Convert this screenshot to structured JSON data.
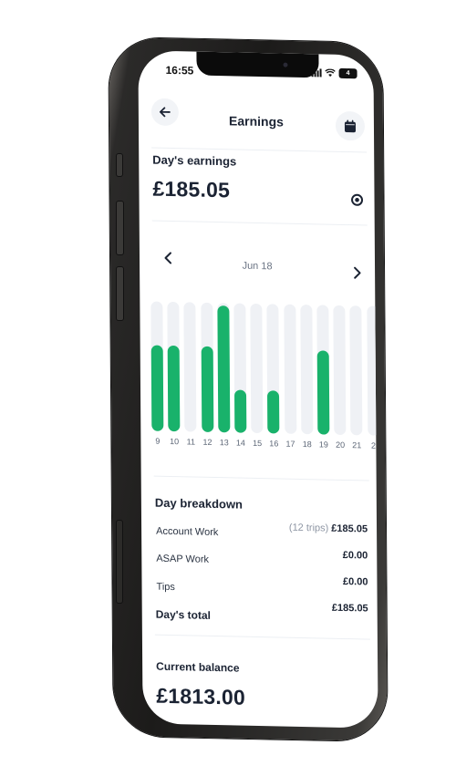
{
  "status_bar": {
    "time": "16:55",
    "battery": "4"
  },
  "header": {
    "title": "Earnings"
  },
  "day_earnings": {
    "label": "Day's earnings",
    "amount": "£185.05"
  },
  "date_nav": {
    "date": "Jun 18"
  },
  "chart_data": {
    "type": "bar",
    "categories": [
      "9",
      "10",
      "11",
      "12",
      "13",
      "14",
      "15",
      "16",
      "17",
      "18",
      "19",
      "20",
      "21",
      "2"
    ],
    "values": [
      0.66,
      0.66,
      0,
      0.66,
      0.98,
      0.33,
      0,
      0.33,
      0,
      0,
      0.65,
      0,
      0,
      0
    ],
    "value_scale": "relative fraction of bar track (no axis printed)",
    "colors": {
      "bar": "#19b26b",
      "track": "#eff1f5"
    },
    "grid": false
  },
  "breakdown": {
    "title": "Day breakdown",
    "rows": [
      {
        "label": "Account Work",
        "trips": "(12 trips)",
        "value": "£185.05"
      },
      {
        "label": "ASAP Work",
        "value": "£0.00"
      },
      {
        "label": "Tips",
        "value": "£0.00"
      }
    ],
    "total_label": "Day's total",
    "total_value": "£185.05"
  },
  "balance": {
    "label": "Current balance",
    "amount": "£1813.00"
  },
  "colors": {
    "accent": "#19b26b",
    "text": "#1b2333",
    "muted": "#6b7484"
  }
}
